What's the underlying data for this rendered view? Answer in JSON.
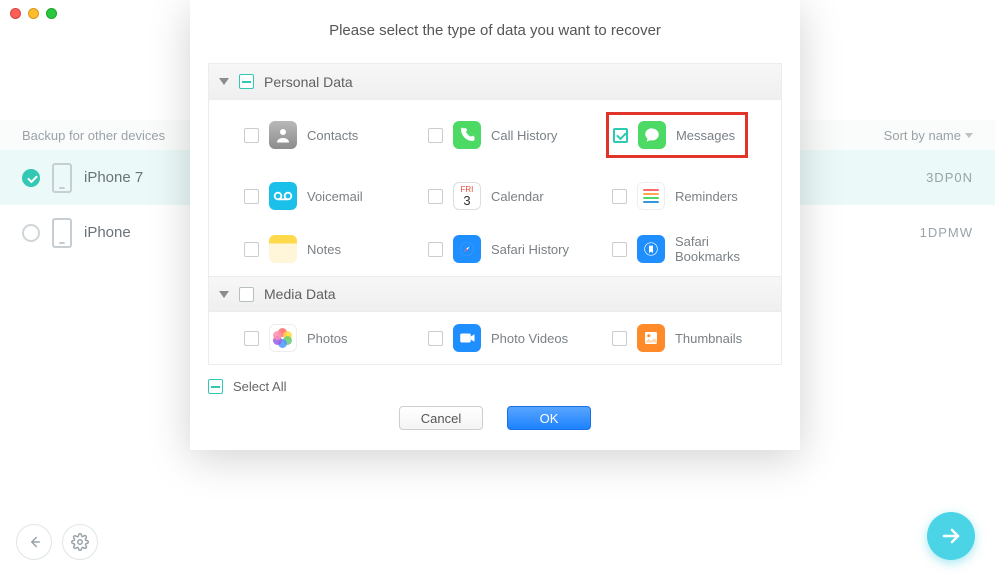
{
  "bg": {
    "backup_label": "Backup for other devices",
    "sort_label": "Sort by name",
    "row1": {
      "name": "iPhone 7",
      "code": "3DP0N"
    },
    "row2": {
      "name": "iPhone",
      "code": "1DPMW"
    }
  },
  "modal": {
    "title": "Please select the type of data you want to recover",
    "sections": [
      {
        "key": "personal",
        "title": "Personal Data",
        "items": [
          {
            "key": "contacts",
            "label": "Contacts",
            "checked": false,
            "iconClass": "ic-contacts"
          },
          {
            "key": "callhistory",
            "label": "Call History",
            "checked": false,
            "iconClass": "ic-call"
          },
          {
            "key": "messages",
            "label": "Messages",
            "checked": true,
            "iconClass": "ic-message",
            "highlight": true
          },
          {
            "key": "voicemail",
            "label": "Voicemail",
            "checked": false,
            "iconClass": "ic-voicemail"
          },
          {
            "key": "calendar",
            "label": "Calendar",
            "checked": false,
            "iconClass": "ic-calendar"
          },
          {
            "key": "reminders",
            "label": "Reminders",
            "checked": false,
            "iconClass": "ic-reminder"
          },
          {
            "key": "notes",
            "label": "Notes",
            "checked": false,
            "iconClass": "ic-notes"
          },
          {
            "key": "safarihx",
            "label": "Safari History",
            "checked": false,
            "iconClass": "ic-safari"
          },
          {
            "key": "safaribm",
            "label": "Safari Bookmarks",
            "checked": false,
            "iconClass": "ic-bookmark"
          }
        ]
      },
      {
        "key": "media",
        "title": "Media Data",
        "items": [
          {
            "key": "photos",
            "label": "Photos",
            "checked": false,
            "iconClass": "ic-photos"
          },
          {
            "key": "photovids",
            "label": "Photo Videos",
            "checked": false,
            "iconClass": "ic-videos"
          },
          {
            "key": "thumbs",
            "label": "Thumbnails",
            "checked": false,
            "iconClass": "ic-thumbs"
          }
        ]
      }
    ],
    "select_all_label": "Select All",
    "cancel_label": "Cancel",
    "ok_label": "OK"
  }
}
